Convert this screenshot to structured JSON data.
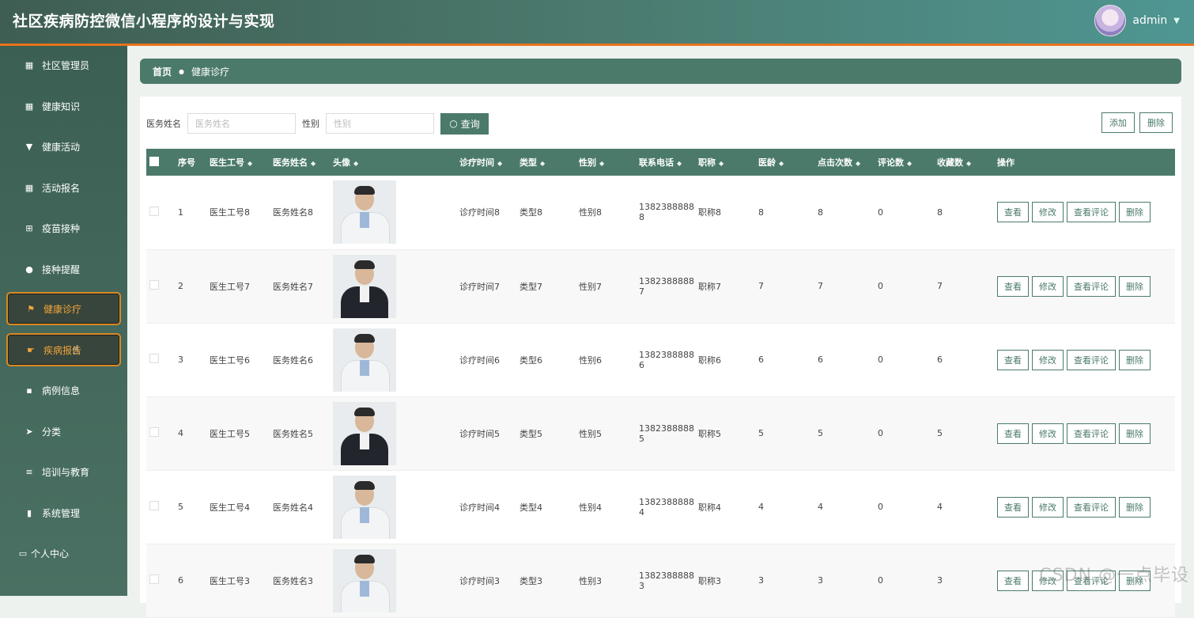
{
  "app": {
    "title": "社区疾病防控微信小程序的设计与实现",
    "user": "admin"
  },
  "sidebar": {
    "items": [
      {
        "label": "社区管理员",
        "icon": "grid-icon"
      },
      {
        "label": "健康知识",
        "icon": "grid-icon"
      },
      {
        "label": "健康活动",
        "icon": "pin-icon"
      },
      {
        "label": "活动报名",
        "icon": "grid-icon"
      },
      {
        "label": "疫苗接种",
        "icon": "apps-icon"
      },
      {
        "label": "接种提醒",
        "icon": "bulb-icon"
      },
      {
        "label": "健康诊疗",
        "icon": "flag-icon",
        "active": true
      },
      {
        "label": "疾病报告",
        "icon": "thumb-icon",
        "active": true
      },
      {
        "label": "病例信息",
        "icon": "chat-icon"
      },
      {
        "label": "分类",
        "icon": "send-icon"
      },
      {
        "label": "培训与教育",
        "icon": "list-icon"
      },
      {
        "label": "系统管理",
        "icon": "bar-chart-icon"
      },
      {
        "label": "个人中心",
        "icon": "card-icon"
      }
    ]
  },
  "breadcrumb": {
    "home": "首页",
    "current": "健康诊疗"
  },
  "search": {
    "name_label": "医务姓名",
    "name_placeholder": "医务姓名",
    "gender_label": "性别",
    "gender_placeholder": "性别",
    "query_button": "查询"
  },
  "toolbar": {
    "add_label": "添加",
    "delete_label": "删除"
  },
  "table": {
    "columns": [
      "序号",
      "医生工号",
      "医务姓名",
      "头像",
      "诊疗时间",
      "类型",
      "性别",
      "联系电话",
      "职称",
      "医龄",
      "点击次数",
      "评论数",
      "收藏数",
      "操作"
    ],
    "action_labels": {
      "view": "查看",
      "edit": "修改",
      "view_comments": "查看评论",
      "delete": "删除"
    },
    "rows": [
      {
        "index": "1",
        "doctor_id": "医生工号8",
        "name": "医务姓名8",
        "photo": "white",
        "time": "诊疗时间8",
        "type": "类型8",
        "gender": "性别8",
        "phone_a": "1382388888",
        "phone_b": "8",
        "title": "职称8",
        "years": "8",
        "clicks": "8",
        "comments": "0",
        "favorites": "8"
      },
      {
        "index": "2",
        "doctor_id": "医生工号7",
        "name": "医务姓名7",
        "photo": "suit",
        "time": "诊疗时间7",
        "type": "类型7",
        "gender": "性别7",
        "phone_a": "1382388888",
        "phone_b": "7",
        "title": "职称7",
        "years": "7",
        "clicks": "7",
        "comments": "0",
        "favorites": "7"
      },
      {
        "index": "3",
        "doctor_id": "医生工号6",
        "name": "医务姓名6",
        "photo": "white",
        "time": "诊疗时间6",
        "type": "类型6",
        "gender": "性别6",
        "phone_a": "1382388888",
        "phone_b": "6",
        "title": "职称6",
        "years": "6",
        "clicks": "6",
        "comments": "0",
        "favorites": "6"
      },
      {
        "index": "4",
        "doctor_id": "医生工号5",
        "name": "医务姓名5",
        "photo": "suit",
        "time": "诊疗时间5",
        "type": "类型5",
        "gender": "性别5",
        "phone_a": "1382388888",
        "phone_b": "5",
        "title": "职称5",
        "years": "5",
        "clicks": "5",
        "comments": "0",
        "favorites": "5"
      },
      {
        "index": "5",
        "doctor_id": "医生工号4",
        "name": "医务姓名4",
        "photo": "white",
        "time": "诊疗时间4",
        "type": "类型4",
        "gender": "性别4",
        "phone_a": "1382388888",
        "phone_b": "4",
        "title": "职称4",
        "years": "4",
        "clicks": "4",
        "comments": "0",
        "favorites": "4"
      },
      {
        "index": "6",
        "doctor_id": "医生工号3",
        "name": "医务姓名3",
        "photo": "white",
        "time": "诊疗时间3",
        "type": "类型3",
        "gender": "性别3",
        "phone_a": "1382388888",
        "phone_b": "3",
        "title": "职称3",
        "years": "3",
        "clicks": "3",
        "comments": "0",
        "favorites": "3"
      }
    ]
  },
  "watermark": "CSDN @一点毕设"
}
